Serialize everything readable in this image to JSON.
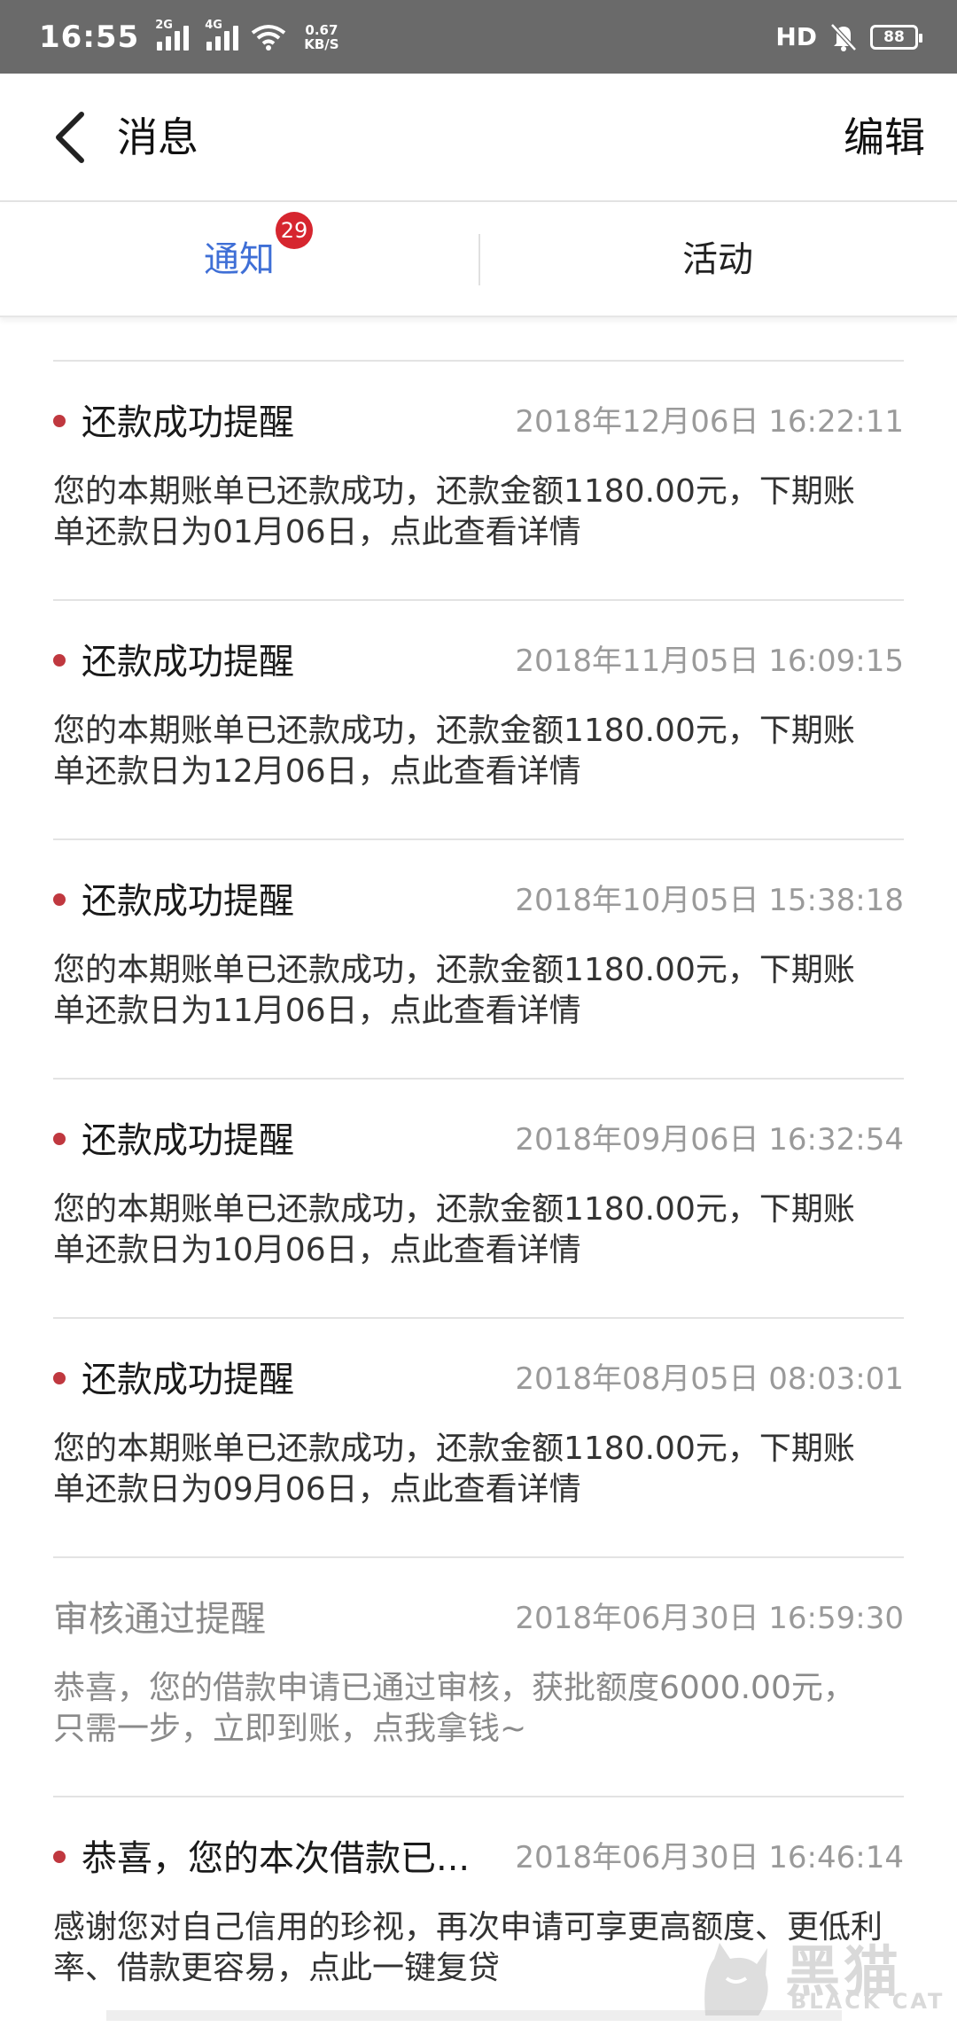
{
  "status_bar": {
    "time": "16:55",
    "net1": "2G",
    "net2": "4G",
    "speed_value": "0.67",
    "speed_unit": "KB/S",
    "hd": "HD",
    "battery": "88"
  },
  "header": {
    "title": "消息",
    "edit_label": "编辑"
  },
  "tabs": [
    {
      "label": "通知",
      "badge": "29",
      "active": true
    },
    {
      "label": "活动",
      "active": false
    }
  ],
  "messages": [
    {
      "title": "还款成功提醒",
      "time": "2018年12月06日 16:22:11",
      "body": "您的本期账单已还款成功，还款金额1180.00元，下期账单还款日为01月06日，点此查看详情",
      "unread": true
    },
    {
      "title": "还款成功提醒",
      "time": "2018年11月05日 16:09:15",
      "body": "您的本期账单已还款成功，还款金额1180.00元，下期账单还款日为12月06日，点此查看详情",
      "unread": true
    },
    {
      "title": "还款成功提醒",
      "time": "2018年10月05日 15:38:18",
      "body": "您的本期账单已还款成功，还款金额1180.00元，下期账单还款日为11月06日，点此查看详情",
      "unread": true
    },
    {
      "title": "还款成功提醒",
      "time": "2018年09月06日 16:32:54",
      "body": "您的本期账单已还款成功，还款金额1180.00元，下期账单还款日为10月06日，点此查看详情",
      "unread": true
    },
    {
      "title": "还款成功提醒",
      "time": "2018年08月05日 08:03:01",
      "body": "您的本期账单已还款成功，还款金额1180.00元，下期账单还款日为09月06日，点此查看详情",
      "unread": true
    },
    {
      "title": "审核通过提醒",
      "time": "2018年06月30日 16:59:30",
      "body": "恭喜，您的借款申请已通过审核，获批额度6000.00元，只需一步，立即到账，点我拿钱~",
      "unread": false
    },
    {
      "title": "恭喜，您的本次借款已...",
      "time": "2018年06月30日 16:46:14",
      "body": "感谢您对自己信用的珍视，再次申请可享更高额度、更低利率、借款更容易，点此一键复贷",
      "unread": true
    }
  ],
  "watermark": {
    "cn": "黑猫",
    "en": "BLACK CAT"
  },
  "colors": {
    "status_bar": "#6a6a6a",
    "active_tab": "#3f6fd6",
    "badge": "#d6262f",
    "unread_dot": "#c0383f"
  }
}
